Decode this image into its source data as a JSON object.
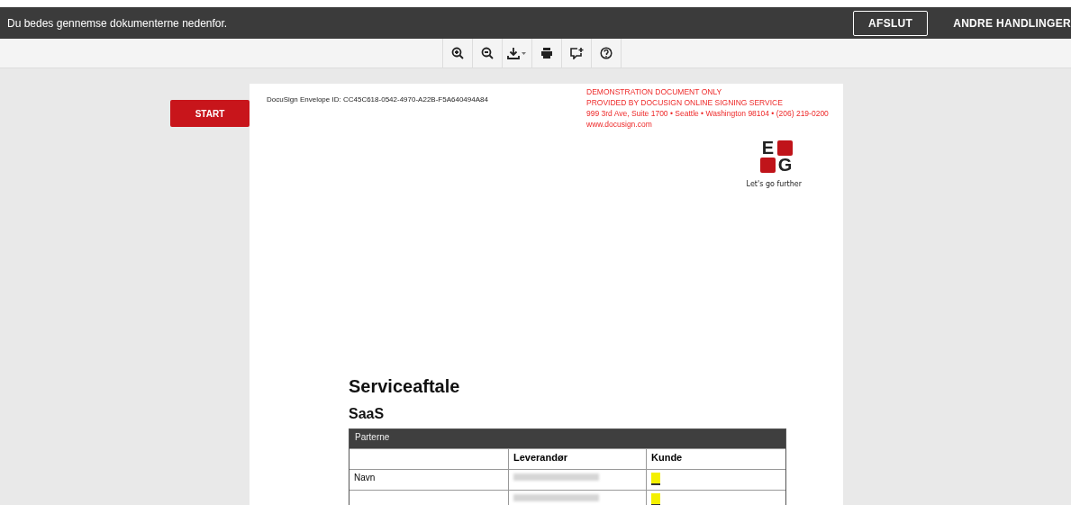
{
  "topbar": {
    "message": "Du bedes gennemse dokumenterne nedenfor.",
    "buttons": [
      {
        "label": "AFSLUT",
        "kind": "outlined"
      },
      {
        "label": "ANDRE HANDLINGER",
        "kind": "menu"
      }
    ]
  },
  "toolbar": {
    "tools": [
      {
        "kind": "zoom-in"
      },
      {
        "kind": "zoom-out"
      },
      {
        "kind": "download"
      },
      {
        "kind": "print"
      },
      {
        "kind": "comment"
      },
      {
        "kind": "help"
      }
    ]
  },
  "start_button": {
    "label": "START"
  },
  "document": {
    "envelope_id": "DocuSign Envelope ID: CC45C618-0542-4970-A22B-F5A640494A84",
    "demo_notice": [
      "DEMONSTRATION DOCUMENT ONLY",
      "PROVIDED BY DOCUSIGN ONLINE SIGNING SERVICE",
      "999 3rd Ave, Suite 1700  • Seattle • Washington 98104 • (206) 219-0200",
      "www.docusign.com"
    ],
    "logo": {
      "letters": [
        "E",
        "G"
      ],
      "tagline": "Let's go further"
    },
    "title": "Serviceaftale",
    "subtitle": "SaaS",
    "table": {
      "caption": "Parterne",
      "columns": [
        "",
        "Leverandør",
        "Kunde"
      ],
      "rows": [
        {
          "label": "Navn",
          "cells": [
            {
              "kind": "redacted"
            },
            {
              "kind": "field"
            }
          ]
        },
        {
          "cells": [
            {
              "kind": "redacted"
            },
            {
              "kind": "field"
            }
          ]
        }
      ]
    }
  }
}
